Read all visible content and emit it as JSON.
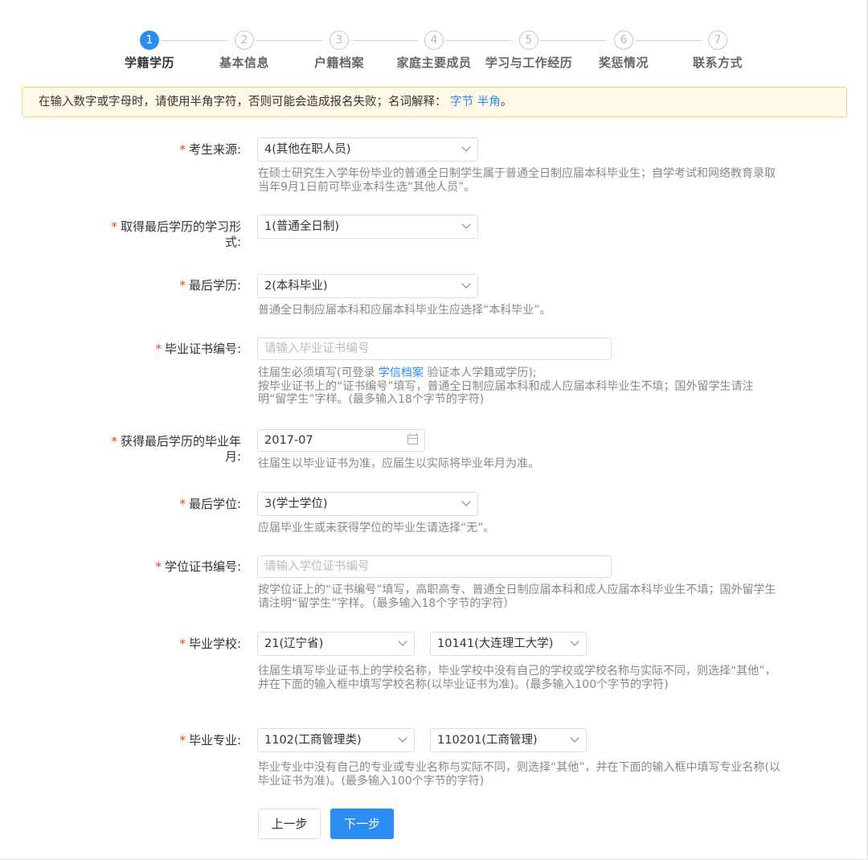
{
  "steps": [
    {
      "num": "1",
      "label": "学籍学历"
    },
    {
      "num": "2",
      "label": "基本信息"
    },
    {
      "num": "3",
      "label": "户籍档案"
    },
    {
      "num": "4",
      "label": "家庭主要成员"
    },
    {
      "num": "5",
      "label": "学习与工作经历"
    },
    {
      "num": "6",
      "label": "奖惩情况"
    },
    {
      "num": "7",
      "label": "联系方式"
    }
  ],
  "notice": {
    "text": "在输入数字或字母时，请使用半角字符，否则可能会造成报名失败；名词解释：",
    "link1": "字节",
    "link2": "半角",
    "end": "。"
  },
  "form": {
    "star": "*",
    "source": {
      "label": "考生来源:",
      "value": "4(其他在职人员)",
      "help": "在硕士研究生入学年份毕业的普通全日制学生属于普通全日制应届本科毕业生；自学考试和网络教育录取当年9月1日前可毕业本科生选“其他人员”。"
    },
    "study_form": {
      "label": "取得最后学历的学习形\n式:",
      "value": "1(普通全日制)"
    },
    "degree_level": {
      "label": "最后学历:",
      "value": "2(本科毕业)",
      "help": "普通全日制应届本科和应届本科毕业生应选择“本科毕业”。"
    },
    "grad_cert": {
      "label": "毕业证书编号:",
      "placeholder": "请输入毕业证书编号",
      "help_prefix": "往届生必须填写(可登录 ",
      "help_link": "学信档案",
      "help_suffix": " 验证本人学籍或学历);",
      "help_rest": "按毕业证书上的“证书编号”填写，普通全日制应届本科和成人应届本科毕业生不填；国外留学生请注明“留学生”字样。(最多输入18个字节的字符)"
    },
    "grad_date": {
      "label": "获得最后学历的毕业年\n月:",
      "value": "2017-07",
      "help": "往届生以毕业证书为准，应届生以实际将毕业年月为准。"
    },
    "last_degree": {
      "label": "最后学位:",
      "value": "3(学士学位)",
      "help": "应届毕业生或未获得学位的毕业生请选择“无”。"
    },
    "degree_cert": {
      "label": "学位证书编号:",
      "placeholder": "请输入学位证书编号",
      "help": "按学位证上的“证书编号”填写，高职高专、普通全日制应届本科和成人应届本科毕业生不填；国外留学生请注明“留学生”字样。（最多输入18个字节的字符）"
    },
    "school": {
      "label": "毕业学校:",
      "province": "21(辽宁省)",
      "school": "10141(大连理工大学)",
      "help": "往届生填写毕业证书上的学校名称，毕业学校中没有自己的学校或学校名称与实际不同，则选择“其他”，并在下面的输入框中填写学校名称(以毕业证书为准)。(最多输入100个字节的字符)"
    },
    "major": {
      "label": "毕业专业:",
      "category": "1102(工商管理类)",
      "major": "110201(工商管理)",
      "help": "毕业专业中没有自己的专业或专业名称与实际不同，则选择“其他”，并在下面的输入框中填写专业名称(以毕业证书为准)。(最多输入100个字节的字符)"
    }
  },
  "buttons": {
    "prev": "上一步",
    "next": "下一步"
  },
  "colors": {
    "primary": "#2d8cf0",
    "required": "#ed4014",
    "notice_bg": "#fff8e6",
    "notice_border": "#f5d58a"
  }
}
